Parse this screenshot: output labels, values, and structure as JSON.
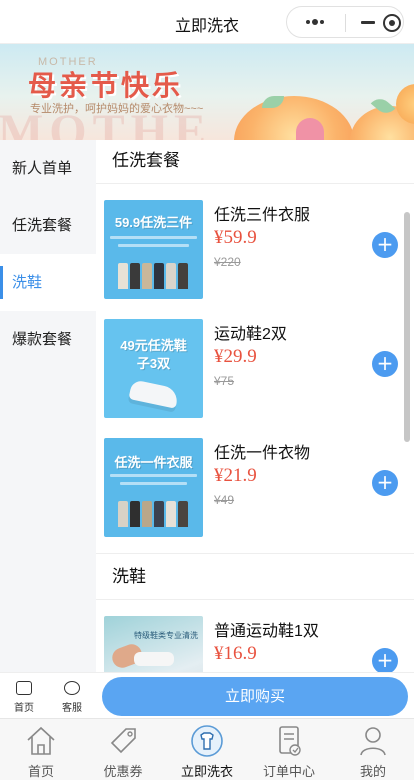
{
  "header": {
    "title": "立即洗衣",
    "capsule_icons": [
      "more-icon",
      "minimize-icon",
      "record-icon"
    ]
  },
  "banner": {
    "title": "母亲节快乐",
    "subtitle": "专业洗护，呵护妈妈的爱心衣物~~~",
    "tagline": "MOTHER",
    "watermark": "MOTHE"
  },
  "sidebar": {
    "items": [
      {
        "label": "新人首单",
        "active": false
      },
      {
        "label": "任洗套餐",
        "active": false
      },
      {
        "label": "洗鞋",
        "active": true
      },
      {
        "label": "爆款套餐",
        "active": false
      }
    ]
  },
  "sections": [
    {
      "title": "任洗套餐",
      "products": [
        {
          "name": "任洗三件衣服",
          "price": "¥59.9",
          "original": "¥220",
          "thumb_title": "59.9任洗三件",
          "thumb_type": "clothes"
        },
        {
          "name": "运动鞋2双",
          "price": "¥29.9",
          "original": "¥75",
          "thumb_title": "49元任洗鞋子3双",
          "thumb_type": "shoe"
        },
        {
          "name": "任洗一件衣物",
          "price": "¥21.9",
          "original": "¥49",
          "thumb_title": "任洗一件衣服",
          "thumb_type": "clothes"
        }
      ]
    },
    {
      "title": "洗鞋",
      "products": [
        {
          "name": "普通运动鞋1双",
          "price": "¥16.9",
          "original": "",
          "thumb_title": "特级鞋类专业清洗",
          "thumb_type": "photo"
        }
      ]
    }
  ],
  "add_button_label": "+",
  "actionbar": {
    "home_label": "首页",
    "service_label": "客服",
    "buy_label": "立即购买"
  },
  "tabbar": {
    "tabs": [
      {
        "label": "首页",
        "icon": "home-icon"
      },
      {
        "label": "优惠券",
        "icon": "coupon-tag-icon"
      },
      {
        "label": "立即洗衣",
        "icon": "laundry-icon",
        "active": true
      },
      {
        "label": "订单中心",
        "icon": "order-list-icon"
      },
      {
        "label": "我的",
        "icon": "user-icon"
      }
    ]
  },
  "colors": {
    "accent": "#3b8fe8",
    "price": "#e8523f",
    "button": "#5aa5f2",
    "sidebar_bg": "#f5f6f8"
  }
}
